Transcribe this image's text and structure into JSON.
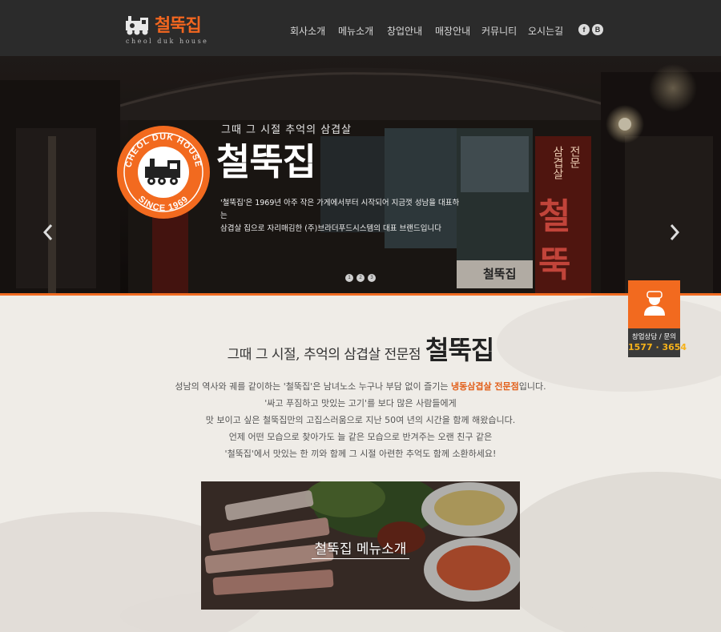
{
  "header": {
    "logo_text": "철뚝집",
    "logo_sub": "cheol duk house",
    "nav": [
      {
        "label": "회사소개"
      },
      {
        "label": "메뉴소개"
      },
      {
        "label": "창업안내"
      },
      {
        "label": "매장안내"
      },
      {
        "label": "커뮤니티"
      },
      {
        "label": "오시는길"
      }
    ],
    "social": [
      {
        "label": "f",
        "icon": "facebook-icon"
      },
      {
        "label": "B",
        "icon": "blog-icon"
      }
    ]
  },
  "hero": {
    "badge_top": "CHEOL DUK HOUSE",
    "badge_bottom": "SINCE 1969",
    "tagline": "그때 그 시절 추억의 삼겹살",
    "title": "철뚝집",
    "desc_line1": "'철뚝집'은 1969년 아주 작은 가게에서부터 시작되어 지금껏 성남을 대표하는",
    "desc_line2": "삼겹살 집으로 자리매김한 (주)브라더푸드시스템의 대표 브랜드입니다",
    "slides": [
      "1",
      "2",
      "3"
    ],
    "sign_text_1": "삼겹살",
    "sign_text_2": "전문",
    "sign_text_3": "철",
    "sign_text_4": "뚝",
    "sign_text_5": "철뚝집"
  },
  "consult": {
    "label": "창업상담 / 문의",
    "phone": "1577 · 3654"
  },
  "section": {
    "title_small": "그때 그 시절, 추억의 삼겹살 전문점",
    "title_big": "철뚝집",
    "line1_pre": "성남의 역사와 궤를 같이하는 '철뚝집'은 남녀노소 누구나 부담 없이 즐기는 ",
    "line1_hl": "냉동삼겹살 전문점",
    "line1_post": "입니다.",
    "line2": "'싸고 푸짐하고 맛있는 고기'를 보다 많은 사람들에게",
    "line3": "맛 보이고 싶은 철뚝집만의 고집스러움으로 지난 50여 년의 시간을 함께 해왔습니다.",
    "line4": "언제 어떤 모습으로 찾아가도 늘 같은 모습으로 반겨주는 오랜 친구 같은",
    "line5": "'철뚝집'에서 맛있는 한 끼와 함께 그 시절 아련한 추억도 함께 소환하세요!",
    "menu_caption": "철뚝집 메뉴소개"
  },
  "colors": {
    "accent": "#f26a1f",
    "header_bg": "#2b2b2b",
    "phone": "#f6b21a"
  }
}
